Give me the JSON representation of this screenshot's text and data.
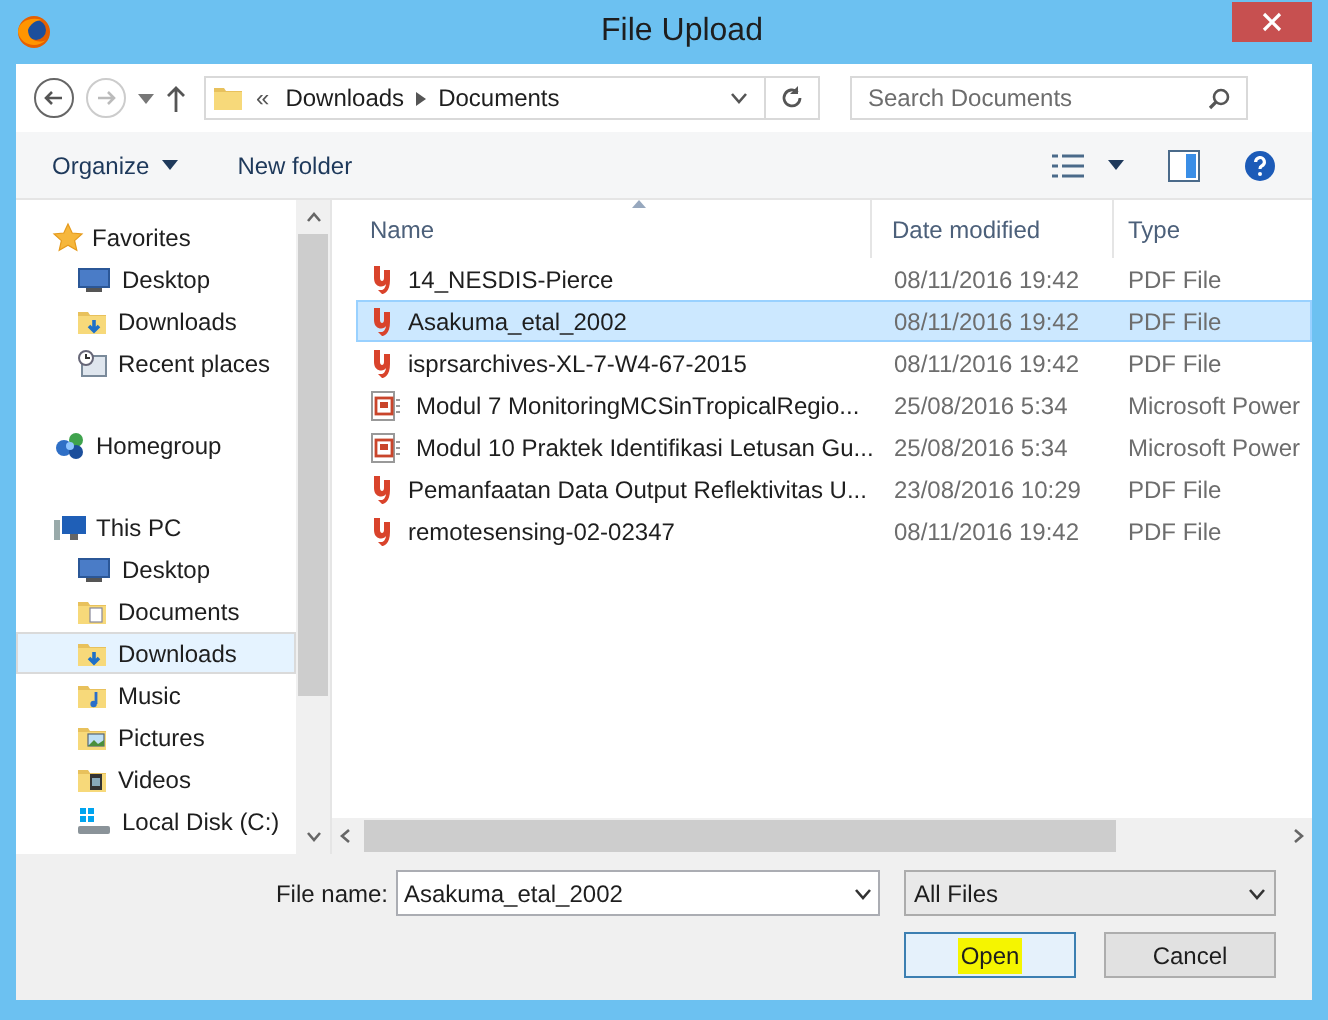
{
  "window": {
    "title": "File Upload"
  },
  "address": {
    "overflow": "«",
    "crumbs": [
      "Downloads",
      "Documents"
    ]
  },
  "search": {
    "placeholder": "Search Documents"
  },
  "toolbar": {
    "organize": "Organize",
    "new_folder": "New folder"
  },
  "sidebar": {
    "groups": [
      {
        "label": "Favorites",
        "kind": "star",
        "selected": false,
        "children": [
          {
            "label": "Desktop",
            "kind": "desktop",
            "selected": false
          },
          {
            "label": "Downloads",
            "kind": "downloads",
            "selected": false
          },
          {
            "label": "Recent places",
            "kind": "recent",
            "selected": false
          }
        ]
      },
      {
        "label": "Homegroup",
        "kind": "homegroup",
        "selected": false
      },
      {
        "label": "This PC",
        "kind": "pc",
        "selected": false,
        "children": [
          {
            "label": "Desktop",
            "kind": "desktop",
            "selected": false
          },
          {
            "label": "Documents",
            "kind": "documents",
            "selected": false
          },
          {
            "label": "Downloads",
            "kind": "downloads",
            "selected": true
          },
          {
            "label": "Music",
            "kind": "music",
            "selected": false
          },
          {
            "label": "Pictures",
            "kind": "pictures",
            "selected": false
          },
          {
            "label": "Videos",
            "kind": "videos",
            "selected": false
          },
          {
            "label": "Local Disk (C:)",
            "kind": "disk",
            "selected": false
          }
        ]
      }
    ]
  },
  "table": {
    "columns": [
      "Name",
      "Date modified",
      "Type"
    ],
    "rows": [
      {
        "kind": "pdf",
        "name": "14_NESDIS-Pierce",
        "date": "08/11/2016 19:42",
        "type": "PDF File",
        "selected": false
      },
      {
        "kind": "pdf",
        "name": "Asakuma_etal_2002",
        "date": "08/11/2016 19:42",
        "type": "PDF File",
        "selected": true
      },
      {
        "kind": "pdf",
        "name": "isprsarchives-XL-7-W4-67-2015",
        "date": "08/11/2016 19:42",
        "type": "PDF File",
        "selected": false
      },
      {
        "kind": "ppt",
        "name": "Modul 7 MonitoringMCSinTropicalRegio...",
        "date": "25/08/2016 5:34",
        "type": "Microsoft Power",
        "selected": false
      },
      {
        "kind": "ppt",
        "name": "Modul 10 Praktek Identifikasi Letusan Gu...",
        "date": "25/08/2016 5:34",
        "type": "Microsoft Power",
        "selected": false
      },
      {
        "kind": "pdf",
        "name": "Pemanfaatan Data Output Reflektivitas U...",
        "date": "23/08/2016 10:29",
        "type": "PDF File",
        "selected": false
      },
      {
        "kind": "pdf",
        "name": "remotesensing-02-02347",
        "date": "08/11/2016 19:42",
        "type": "PDF File",
        "selected": false
      }
    ]
  },
  "file_name": {
    "label": "File name:",
    "value": "Asakuma_etal_2002"
  },
  "file_type": {
    "value": "All Files"
  },
  "buttons": [
    {
      "label": "Open",
      "kind": "default",
      "highlighted": true
    },
    {
      "label": "Cancel",
      "kind": "normal",
      "highlighted": false
    }
  ]
}
